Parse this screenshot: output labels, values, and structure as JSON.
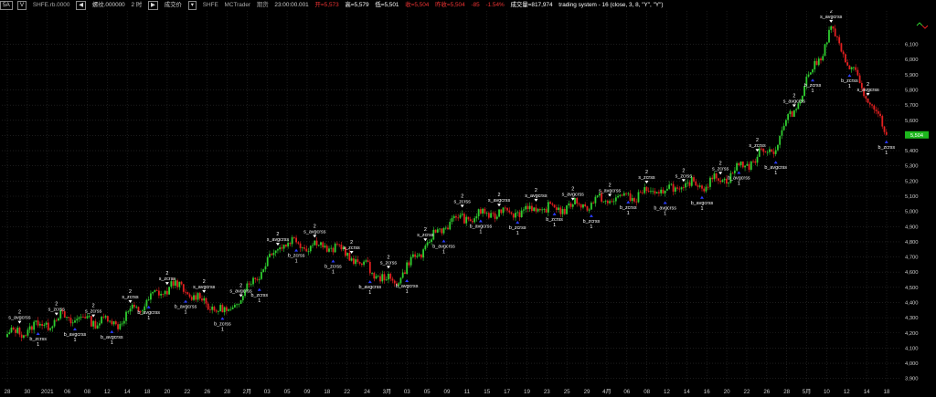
{
  "toolbar": {
    "interval_button": "5A",
    "interval_button2": "V",
    "symbol": "SHFE.rb.0000",
    "stepper_label": "螺纹.000000",
    "timeframe": "2 时",
    "chip1": "成交价",
    "exchange": "SHFE",
    "source": "MCTrader",
    "kind": "期货",
    "time": "23:00:00.001",
    "open": "开=5,573",
    "high": "高=5,579",
    "low": "低=5,501",
    "close": "收=5,504",
    "prev": "昨收=5,504",
    "change": "-85",
    "change_pct": "-1.54%",
    "volume": "成交量=817,974",
    "study": "trading system - 16 (close,  3,  8,  \"Y\",  \"Y\")"
  },
  "colors": {
    "background": "#000000",
    "grid": "#2e2e2e",
    "up": "#2fcc2f",
    "down": "#e22020",
    "buy_marker": "#2a3cff",
    "sell_marker": "#ffffff",
    "price_badge": "#1db71d"
  },
  "chart_data": {
    "type": "candlestick",
    "title": "",
    "xlabel": "",
    "ylabel": "",
    "ylim": [
      3880,
      6320
    ],
    "y_ticks": [
      "3,900",
      "4,000",
      "4,100",
      "4,200",
      "4,300",
      "4,400",
      "4,500",
      "4,600",
      "4,700",
      "4,800",
      "4,900",
      "5,000",
      "5,100",
      "5,200",
      "5,300",
      "5,400",
      "5,500",
      "5,600",
      "5,700",
      "5,800",
      "5,900",
      "6,000",
      "6,100"
    ],
    "x_ticks": [
      "28",
      "30",
      "2021",
      "06",
      "08",
      "12",
      "14",
      "18",
      "20",
      "22",
      "26",
      "28",
      "2月",
      "03",
      "05",
      "09",
      "18",
      "22",
      "24",
      "3月",
      "03",
      "05",
      "09",
      "11",
      "15",
      "17",
      "19",
      "23",
      "25",
      "29",
      "4月",
      "06",
      "08",
      "12",
      "14",
      "16",
      "20",
      "22",
      "26",
      "28",
      "5月",
      "10",
      "12",
      "14",
      "18"
    ],
    "last_price": "5,504",
    "series": [
      {
        "x": [
          0,
          0.24,
          0.4,
          0.6,
          0.84,
          1.0
        ],
        "close": [
          4180,
          4300,
          4270,
          4520,
          4320,
          4800,
          4760,
          4520,
          4930,
          5000,
          5020,
          5080,
          5140,
          5210,
          5440,
          6190,
          5504
        ]
      },
      {
        "x": [
          0,
          1
        ],
        "close": [
          4200,
          4300
        ]
      }
    ],
    "signals": [
      {
        "label": "s_avgcrss",
        "count": "2"
      },
      {
        "label": "b_avgcrss",
        "count": "1"
      },
      {
        "label": "s_zcrss",
        "count": "2"
      },
      {
        "label": "b_zcrss",
        "count": "1"
      }
    ]
  }
}
